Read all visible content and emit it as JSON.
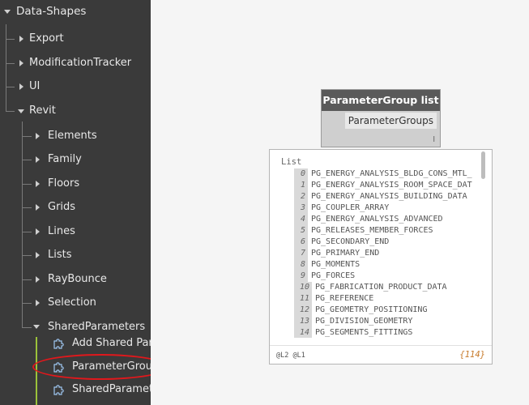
{
  "sidebar": {
    "root_label": "Data-Shapes",
    "items": [
      {
        "label": "Export"
      },
      {
        "label": "ModificationTracker"
      },
      {
        "label": "UI"
      },
      {
        "label": "Revit"
      }
    ],
    "revit_children": [
      {
        "label": "Elements"
      },
      {
        "label": "Family"
      },
      {
        "label": "Floors"
      },
      {
        "label": "Grids"
      },
      {
        "label": "Lines"
      },
      {
        "label": "Lists"
      },
      {
        "label": "RayBounce"
      },
      {
        "label": "Selection"
      },
      {
        "label": "SharedParameters"
      }
    ],
    "shared_params_nodes": [
      {
        "label": "Add Shared Para"
      },
      {
        "label": "ParameterGroup"
      },
      {
        "label": "SharedParamete"
      }
    ]
  },
  "node": {
    "title": "ParameterGroup list",
    "output_port": "ParameterGroups",
    "lacing": "l"
  },
  "preview": {
    "list_title": "List",
    "items": [
      {
        "index": "0",
        "value": "PG_ENERGY_ANALYSIS_BLDG_CONS_MTL_"
      },
      {
        "index": "1",
        "value": "PG_ENERGY_ANALYSIS_ROOM_SPACE_DAT"
      },
      {
        "index": "2",
        "value": "PG_ENERGY_ANALYSIS_BUILDING_DATA"
      },
      {
        "index": "3",
        "value": "PG_COUPLER_ARRAY"
      },
      {
        "index": "4",
        "value": "PG_ENERGY_ANALYSIS_ADVANCED"
      },
      {
        "index": "5",
        "value": "PG_RELEASES_MEMBER_FORCES"
      },
      {
        "index": "6",
        "value": "PG_SECONDARY_END"
      },
      {
        "index": "7",
        "value": "PG_PRIMARY_END"
      },
      {
        "index": "8",
        "value": "PG_MOMENTS"
      },
      {
        "index": "9",
        "value": "PG_FORCES"
      },
      {
        "index": "10",
        "value": "PG_FABRICATION_PRODUCT_DATA"
      },
      {
        "index": "11",
        "value": "PG_REFERENCE"
      },
      {
        "index": "12",
        "value": "PG_GEOMETRY_POSITIONING"
      },
      {
        "index": "13",
        "value": "PG_DIVISION_GEOMETRY"
      },
      {
        "index": "14",
        "value": "PG_SEGMENTS_FITTINGS"
      }
    ],
    "levels": "@L2 @L1",
    "count": "{114}"
  },
  "colors": {
    "sidebar_bg": "#3a3a3a",
    "tree_line": "#7a7a7a",
    "accent_green": "#9bc23a",
    "highlight_red": "#e0181c",
    "count_orange": "#c77a2a"
  }
}
